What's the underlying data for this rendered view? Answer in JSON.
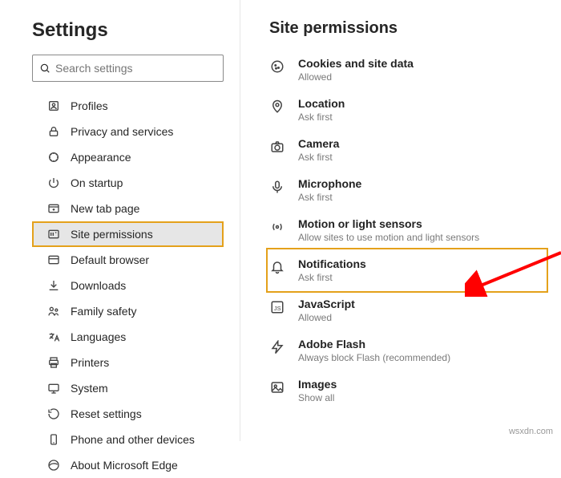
{
  "sidebar": {
    "title": "Settings",
    "search_placeholder": "Search settings",
    "items": [
      {
        "label": "Profiles"
      },
      {
        "label": "Privacy and services"
      },
      {
        "label": "Appearance"
      },
      {
        "label": "On startup"
      },
      {
        "label": "New tab page"
      },
      {
        "label": "Site permissions",
        "active": true,
        "highlight": true
      },
      {
        "label": "Default browser"
      },
      {
        "label": "Downloads"
      },
      {
        "label": "Family safety"
      },
      {
        "label": "Languages"
      },
      {
        "label": "Printers"
      },
      {
        "label": "System"
      },
      {
        "label": "Reset settings"
      },
      {
        "label": "Phone and other devices"
      },
      {
        "label": "About Microsoft Edge"
      }
    ]
  },
  "main": {
    "title": "Site permissions",
    "items": [
      {
        "title": "Cookies and site data",
        "sub": "Allowed"
      },
      {
        "title": "Location",
        "sub": "Ask first"
      },
      {
        "title": "Camera",
        "sub": "Ask first"
      },
      {
        "title": "Microphone",
        "sub": "Ask first"
      },
      {
        "title": "Motion or light sensors",
        "sub": "Allow sites to use motion and light sensors"
      },
      {
        "title": "Notifications",
        "sub": "Ask first",
        "highlight": true
      },
      {
        "title": "JavaScript",
        "sub": "Allowed"
      },
      {
        "title": "Adobe Flash",
        "sub": "Always block Flash (recommended)"
      },
      {
        "title": "Images",
        "sub": "Show all"
      }
    ]
  },
  "watermark": "wsxdn.com"
}
